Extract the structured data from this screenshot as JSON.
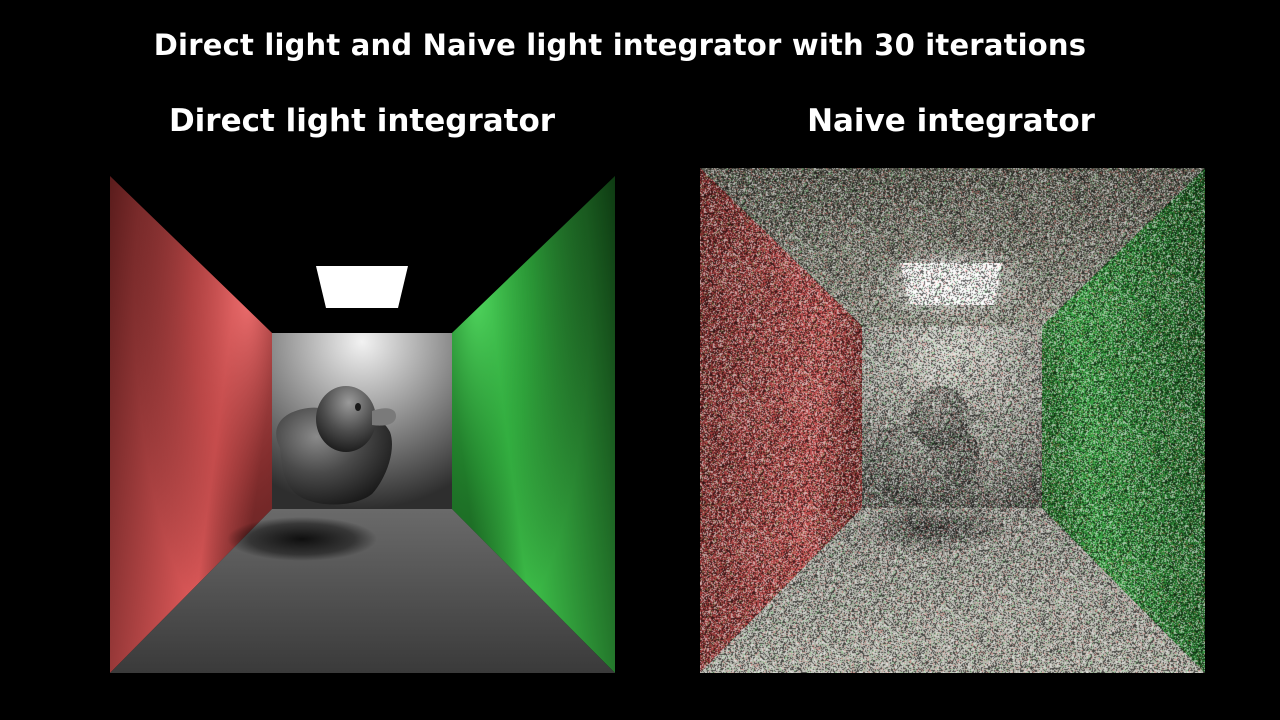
{
  "slide": {
    "title": "Direct light and Naive light integrator with 30 iterations"
  },
  "panels": [
    {
      "caption": "Direct light integrator"
    },
    {
      "caption": "Naive integrator"
    }
  ],
  "colors": {
    "background": "#000000",
    "red_wall": "#c04848",
    "green_wall": "#2fa03a",
    "back_wall": "#bdbdbd",
    "light": "#ffffff",
    "floor": "#454545"
  }
}
